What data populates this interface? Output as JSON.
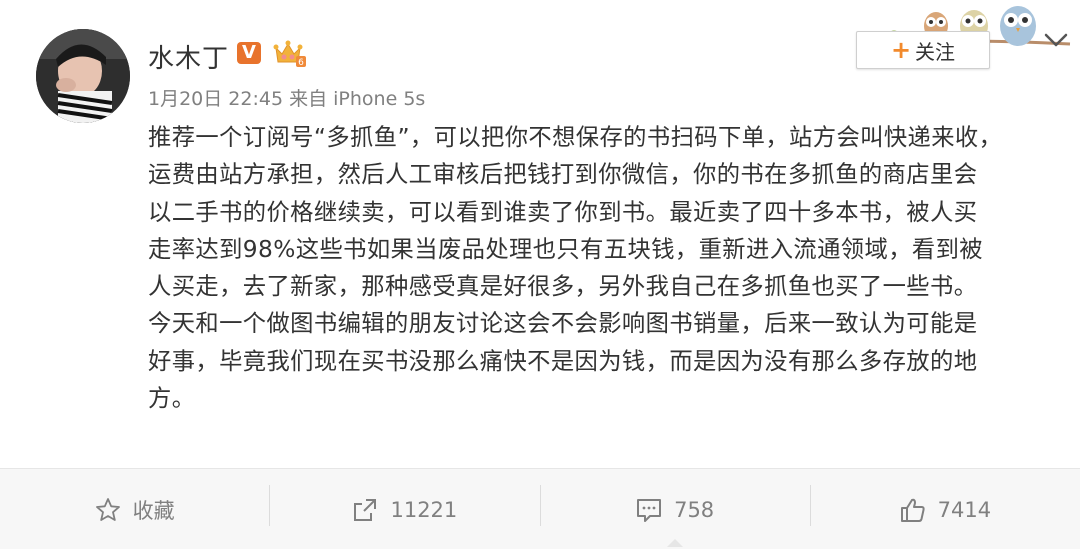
{
  "post": {
    "username": "水木丁",
    "verified_badge": "V",
    "vip_badge_level": "6",
    "meta": "1月20日 22:45 来自 iPhone 5s",
    "follow_button": {
      "plus": "+",
      "label": "关注"
    },
    "content_lines": [
      "推荐一个订阅号“多抓鱼”，可以把你不想保存的书扫码下单，站方会叫快递来收，",
      "运费由站方承担，然后人工审核后把钱打到你微信，你的书在多抓鱼的商店里会",
      "以二手书的价格继续卖，可以看到谁卖了你到书。最近卖了四十多本书，被人买",
      "走率达到98%这些书如果当废品处理也只有五块钱，重新进入流通领域，看到被",
      "人买走，去了新家，那种感受真是好很多，另外我自己在多抓鱼也买了一些书。",
      "今天和一个做图书编辑的朋友讨论这会不会影响图书销量，后来一致认为可能是",
      "好事，毕竟我们现在买书没那么痛快不是因为钱，而是因为没有那么多存放的地",
      "方。"
    ]
  },
  "actions": {
    "favorite": {
      "label": "收藏",
      "icon": "star-icon"
    },
    "repost": {
      "count": "11221",
      "icon": "share-icon"
    },
    "comment": {
      "count": "758",
      "icon": "comment-icon"
    },
    "like": {
      "count": "7414",
      "icon": "thumbs-up-icon"
    }
  },
  "colors": {
    "text": "#333333",
    "meta": "#808080",
    "verified": "#e8732c",
    "follow_plus": "#f28a2c",
    "footer_bg": "#f7f7f7"
  }
}
